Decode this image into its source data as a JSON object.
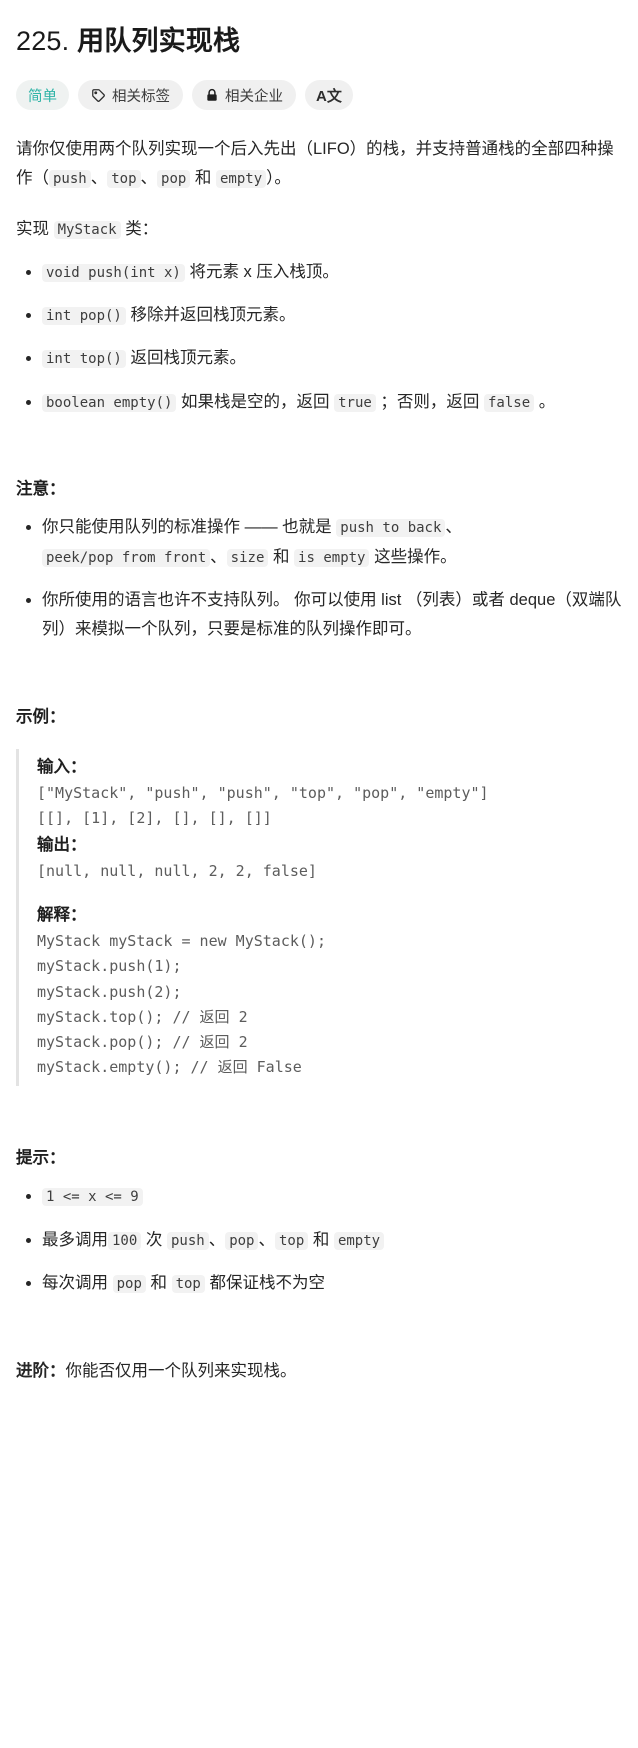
{
  "header": {
    "title_number": "225.",
    "title_text": "用队列实现栈",
    "badges": [
      {
        "name": "difficulty",
        "label": "简单",
        "icon": null
      },
      {
        "name": "related-tags",
        "label": "相关标签",
        "icon": "tag-icon"
      },
      {
        "name": "related-companies",
        "label": "相关企业",
        "icon": "lock-icon"
      },
      {
        "name": "translate",
        "label": "A文",
        "icon": "translate-icon"
      }
    ],
    "difficulty_color": "#2db3a6"
  },
  "description": {
    "intro_1": "请你仅使用两个队列实现一个后入先出（LIFO）的栈，并支持普通栈的全部四种操作（",
    "intro_codes": [
      "push",
      "top",
      "pop",
      "empty"
    ],
    "intro_sep1": "、",
    "intro_sep2": "、",
    "intro_and": " 和 ",
    "intro_tail": "）。",
    "impl_prefix": "实现 ",
    "impl_code": "MyStack",
    "impl_suffix": " 类：",
    "methods": [
      {
        "code": "void push(int x)",
        "text": " 将元素 x 压入栈顶。"
      },
      {
        "code": "int pop()",
        "text": " 移除并返回栈顶元素。"
      },
      {
        "code": "int top()",
        "text": " 返回栈顶元素。"
      }
    ],
    "empty_method": {
      "code": "boolean empty()",
      "text_1": " 如果栈是空的，返回 ",
      "code_true": "true",
      "text_2": " ；否则，返回 ",
      "code_false": "false",
      "text_3": " 。"
    }
  },
  "notes": {
    "heading": "注意：",
    "item1": {
      "text_1": "你只能使用队列的标准操作 —— 也就是 ",
      "code_1": "push to back",
      "sep_1": "、",
      "code_2": "peek/pop from front",
      "sep_2": "、",
      "code_3": "size",
      "and": " 和 ",
      "code_4": "is empty",
      "text_2": " 这些操作。"
    },
    "item2": "你所使用的语言也许不支持队列。 你可以使用 list （列表）或者 deque（双端队列）来模拟一个队列，只要是标准的队列操作即可。"
  },
  "example": {
    "heading": "示例：",
    "input_label": "输入：",
    "input_line_1": "[\"MyStack\", \"push\", \"push\", \"top\", \"pop\", \"empty\"]",
    "input_line_2": "[[], [1], [2], [], [], []]",
    "output_label": "输出：",
    "output_line": "[null, null, null, 2, 2, false]",
    "explanation_label": "解释：",
    "explanation_lines": "MyStack myStack = new MyStack();\nmyStack.push(1);\nmyStack.push(2);\nmyStack.top(); // 返回 2\nmyStack.pop(); // 返回 2\nmyStack.empty(); // 返回 False"
  },
  "hints": {
    "heading": "提示：",
    "item1_code": "1 <= x <= 9",
    "item2": {
      "text_1": "最多调用",
      "code_1": "100",
      "text_2": " 次 ",
      "code_2": "push",
      "sep_1": "、",
      "code_3": "pop",
      "sep_2": "、",
      "code_4": "top",
      "and": " 和 ",
      "code_5": "empty"
    },
    "item3": {
      "text_1": "每次调用 ",
      "code_1": "pop",
      "and": " 和 ",
      "code_2": "top",
      "text_2": " 都保证栈不为空"
    }
  },
  "followup": {
    "label": "进阶：",
    "text": "你能否仅用一个队列来实现栈。"
  }
}
